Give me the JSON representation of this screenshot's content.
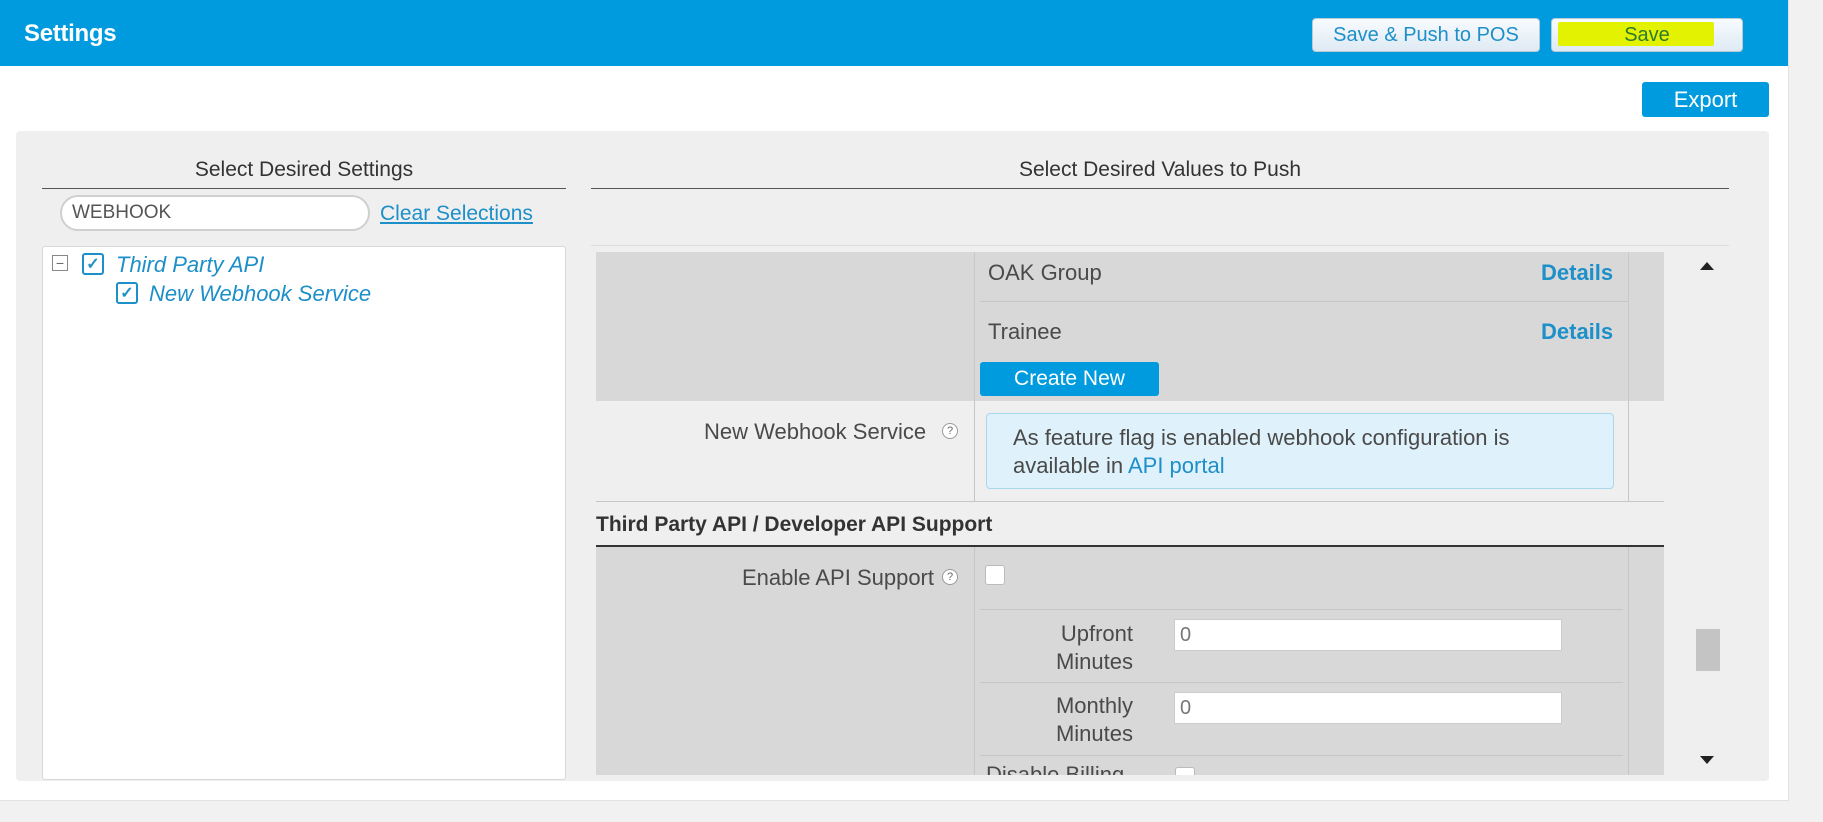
{
  "header": {
    "title": "Settings",
    "save_push_label": "Save & Push to POS",
    "save_label": "Save",
    "export_label": "Export"
  },
  "left_panel": {
    "heading": "Select Desired Settings",
    "search_value": "WEBHOOK",
    "clear_label": "Clear Selections",
    "tree": {
      "parent_label": "Third Party API",
      "child_label": "New Webhook Service"
    }
  },
  "right_panel": {
    "heading": "Select Desired Values to Push",
    "groups": [
      {
        "name": "OAK Group",
        "action": "Details"
      },
      {
        "name": "Trainee",
        "action": "Details"
      }
    ],
    "create_new_label": "Create New",
    "webhook": {
      "label": "New Webhook Service",
      "help": "?",
      "info_text": "As feature flag is enabled webhook configuration is available in ",
      "info_link": "API portal"
    },
    "section_title": "Third Party API / Developer API Support",
    "enable_api": {
      "label": "Enable API Support",
      "help": "?"
    },
    "upfront": {
      "label_line1": "Upfront",
      "label_line2": "Minutes",
      "value": "0"
    },
    "monthly": {
      "label_line1": "Monthly",
      "label_line2": "Minutes",
      "value": "0"
    },
    "cut_label": "Disable Billing"
  },
  "colors": {
    "primary": "#009bde",
    "highlight": "#e3f200",
    "link": "#1d8fc9"
  }
}
